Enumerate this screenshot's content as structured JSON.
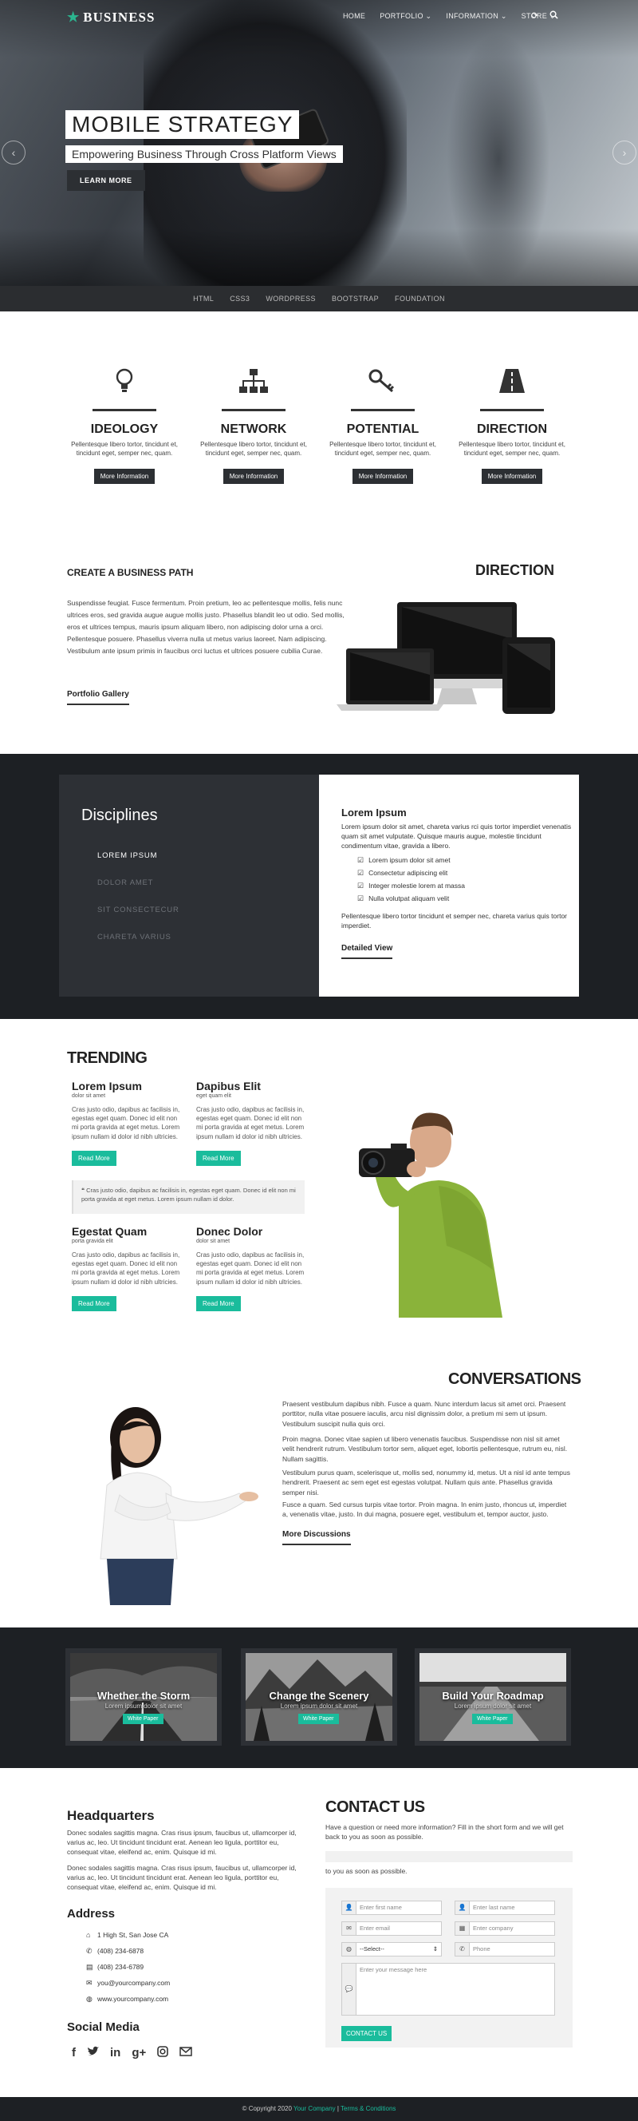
{
  "nav": {
    "brand": "BUSINESS",
    "items": [
      "HOME",
      "PORTFOLIO ⌄",
      "INFORMATION ⌄",
      "STORE ⌄"
    ],
    "icons": [
      "refresh-icon",
      "search-icon"
    ]
  },
  "hero": {
    "title": "MOBILE STRATEGY",
    "subtitle": "Empowering Business Through Cross Platform Views",
    "button": "LEARN MORE"
  },
  "tags": [
    "HTML",
    "CSS3",
    "WORDPRESS",
    "BOOTSTRAP",
    "FOUNDATION"
  ],
  "features": [
    {
      "icon": "lightbulb-icon",
      "title": "IDEOLOGY",
      "text": "Pellentesque libero tortor, tincidunt et, tincidunt eget, semper nec, quam.",
      "button": "More Information"
    },
    {
      "icon": "sitemap-icon",
      "title": "NETWORK",
      "text": "Pellentesque libero tortor, tincidunt et, tincidunt eget, semper nec, quam.",
      "button": "More Information"
    },
    {
      "icon": "key-icon",
      "title": "POTENTIAL",
      "text": "Pellentesque libero tortor, tincidunt et, tincidunt eget, semper nec, quam.",
      "button": "More Information"
    },
    {
      "icon": "road-icon",
      "title": "DIRECTION",
      "text": "Pellentesque libero tortor, tincidunt et, tincidunt eget, semper nec, quam.",
      "button": "More Information"
    }
  ],
  "business_path": {
    "title": "CREATE A BUSINESS PATH",
    "text": "Suspendisse feugiat. Fusce fermentum. Proin pretium, leo ac pellentesque mollis, felis nunc ultrices eros, sed gravida augue augue mollis justo. Phasellus blandit leo ut odio. Sed mollis, eros et ultrices tempus, mauris ipsum aliquam libero, non adipiscing dolor urna a orci. Pellentesque posuere. Phasellus viverra nulla ut metus varius laoreet. Nam adipiscing. Vestibulum ante ipsum primis in faucibus orci luctus et ultrices posuere cubilia Curae.",
    "link": "Portfolio Gallery",
    "right_title": "DIRECTION"
  },
  "disciplines": {
    "title": "Disciplines",
    "items": [
      "LOREM IPSUM",
      "DOLOR AMET",
      "SIT CONSECTECUR",
      "CHARETA VARIUS"
    ],
    "panel_title": "Lorem Ipsum",
    "panel_text": "Lorem ipsum dolor sit amet, chareta varius rci quis tortor imperdiet venenatis quam sit amet vulputate. Quisque mauris augue, molestie tincidunt condimentum vitae, gravida a libero.",
    "checks": [
      "Lorem ipsum dolor sit amet",
      "Consectetur adipiscing elit",
      "Integer molestie lorem at massa",
      "Nulla volutpat aliquam velit"
    ],
    "panel_text2": "Pellentesque libero tortor tincidunt et semper nec, chareta varius quis tortor imperdiet.",
    "link": "Detailed View"
  },
  "trending": {
    "title": "TRENDING",
    "cards": [
      {
        "title": "Lorem Ipsum",
        "sub": "dolor sit amet",
        "text": "Cras justo odio, dapibus ac facilisis in, egestas eget quam. Donec id elit non mi porta gravida at eget metus. Lorem ipsum nullam id dolor id nibh ultricies.",
        "button": "Read More"
      },
      {
        "title": "Dapibus Elit",
        "sub": "eget quam elit",
        "text": "Cras justo odio, dapibus ac facilisis in, egestas eget quam. Donec id elit non mi porta gravida at eget metus. Lorem ipsum nullam id dolor id nibh ultricies.",
        "button": "Read More"
      },
      {
        "title": "Egestat Quam",
        "sub": "porta gravida elit",
        "text": "Cras justo odio, dapibus ac facilisis in, egestas eget quam. Donec id elit non mi porta gravida at eget metus. Lorem ipsum nullam id dolor id nibh ultricies.",
        "button": "Read More"
      },
      {
        "title": "Donec Dolor",
        "sub": "dolor sit amet",
        "text": "Cras justo odio, dapibus ac facilisis in, egestas eget quam. Donec id elit non mi porta gravida at eget metus. Lorem ipsum nullam id dolor id nibh ultricies.",
        "button": "Read More"
      }
    ],
    "quote": "Cras justo odio, dapibus ac facilisis in, egestas eget quam. Donec id elit non mi porta gravida at eget metus. Lorem ipsum nullam id dolor."
  },
  "conversations": {
    "title": "CONVERSATIONS",
    "paragraphs": [
      "Praesent vestibulum dapibus nibh. Fusce a quam. Nunc interdum lacus sit amet orci. Praesent porttitor, nulla vitae posuere iaculis, arcu nisl dignissim dolor, a pretium mi sem ut ipsum. Vestibulum suscipit nulla quis orci.",
      "Proin magna. Donec vitae sapien ut libero venenatis faucibus. Suspendisse non nisl sit amet velit hendrerit rutrum. Vestibulum tortor sem, aliquet eget, lobortis pellentesque, rutrum eu, nisl. Nullam sagittis.",
      "Vestibulum purus quam, scelerisque ut, mollis sed, nonummy id, metus. Ut a nisl id ante tempus hendrerit. Praesent ac sem eget est egestas volutpat. Nullam quis ante. Phasellus gravida semper nisi.",
      "Fusce a quam. Sed cursus turpis vitae tortor. Proin magna. In enim justo, rhoncus ut, imperdiet a, venenatis vitae, justo. In dui magna, posuere eget, vestibulum et, tempor auctor, justo."
    ],
    "link": "More Discussions"
  },
  "gallery": [
    {
      "title": "Whether the Storm",
      "sub": "Lorem ipsum dolor sit amet",
      "button": "White Paper"
    },
    {
      "title": "Change the Scenery",
      "sub": "Lorem ipsum dolor sit amet",
      "button": "White Paper"
    },
    {
      "title": "Build Your Roadmap",
      "sub": "Lorem ipsum dolor sit amet",
      "button": "White Paper"
    }
  ],
  "contact": {
    "hq_title": "Headquarters",
    "hq_p1": "Donec sodales sagittis magna. Cras risus ipsum, faucibus ut, ullamcorper id, varius ac, leo. Ut tincidunt tincidunt erat. Aenean leo ligula, porttitor eu, consequat vitae, eleifend ac, enim. Quisque id mi.",
    "hq_p2": "Donec sodales sagittis magna. Cras risus ipsum, faucibus ut, ullamcorper id, varius ac, leo. Ut tincidunt tincidunt erat. Aenean leo ligula, porttitor eu, consequat vitae, eleifend ac, enim. Quisque id mi.",
    "address_title": "Address",
    "address_items": [
      {
        "icon": "home-icon",
        "text": "1 High St, San Jose CA"
      },
      {
        "icon": "phone-icon",
        "text": "(408) 234-6878"
      },
      {
        "icon": "print-icon",
        "text": "(408) 234-6789"
      },
      {
        "icon": "email-icon",
        "text": "you@yourcompany.com"
      },
      {
        "icon": "globe-icon",
        "text": "www.yourcompany.com"
      }
    ],
    "social_title": "Social Media",
    "social": [
      "facebook-icon",
      "twitter-icon",
      "linkedin-icon",
      "googleplus-icon",
      "instagram-icon",
      "mail-icon"
    ],
    "form_title": "CONTACT US",
    "form_text": "Have a question or need more information? Fill in the short form and we will get back to you as soon as possible.",
    "form_text2": "to you as soon as possible.",
    "fields": {
      "first": "Enter first name",
      "last": "Enter last name",
      "email": "Enter email",
      "company": "Enter company",
      "select": "--Select--",
      "phone": "Phone",
      "message": "Enter your message here"
    },
    "send": "CONTACT US"
  },
  "footer": {
    "copy": "© Copyright 2020",
    "company": "Your Company",
    "sep": "|",
    "terms": "Terms & Conditions"
  }
}
